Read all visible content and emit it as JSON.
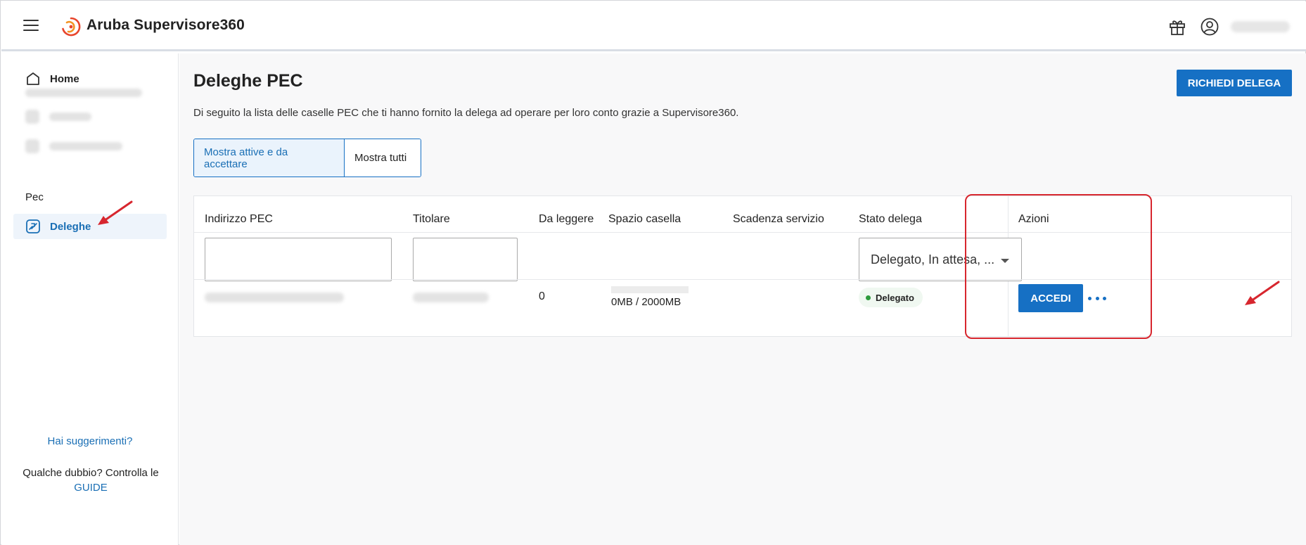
{
  "header": {
    "brand": "Aruba Supervisore360"
  },
  "sidebar": {
    "home_label": "Home",
    "section_label": "Pec",
    "deleghe_label": "Deleghe",
    "suggestions_link": "Hai suggerimenti?",
    "help_text": "Qualche dubbio? Controlla le",
    "help_link": "GUIDE"
  },
  "main": {
    "title": "Deleghe PEC",
    "description": "Di seguito la lista delle caselle PEC che ti hanno fornito la delega ad operare per loro conto grazie a Supervisore360.",
    "request_button": "RICHIEDI DELEGA",
    "toggle": {
      "active_label": "Mostra attive e da accettare",
      "all_label": "Mostra tutti"
    }
  },
  "table": {
    "columns": [
      "Indirizzo PEC",
      "Titolare",
      "Da leggere",
      "Spazio casella",
      "Scadenza servizio",
      "Stato delega",
      "Azioni"
    ],
    "status_filter_value": "Delegato, In attesa, ...",
    "rows": [
      {
        "unread": "0",
        "storage": "0MB / 2000MB",
        "storage_used_fraction": 0,
        "status": "Delegato",
        "action_label": "ACCEDI"
      }
    ]
  },
  "colors": {
    "primary": "#1670c4",
    "link": "#1a6fb5",
    "status_ok": "#2e9a3d",
    "annotation": "#d7262e"
  },
  "icons": {
    "menu": "hamburger-icon",
    "logo": "aruba-logo-icon",
    "gift": "gift-icon",
    "user": "user-circle-icon",
    "home": "home-icon",
    "deleghe": "delegation-icon",
    "more": "more-horizontal-icon",
    "dropdown": "caret-down-icon"
  }
}
